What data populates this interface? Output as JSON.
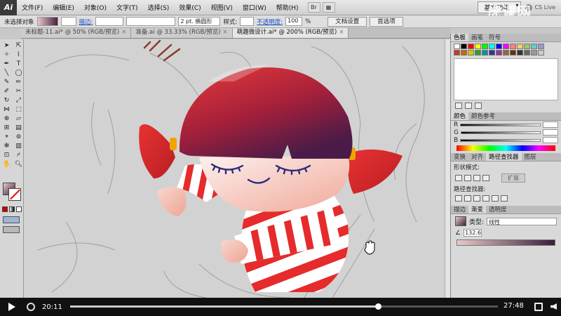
{
  "menubar": {
    "logo": "Ai",
    "items": [
      "文件(F)",
      "编辑(E)",
      "对象(O)",
      "文字(T)",
      "选择(S)",
      "效果(C)",
      "视图(V)",
      "窗口(W)",
      "帮助(H)"
    ],
    "workspace": "基本功能",
    "cs_live": "CS Live",
    "watermark": "虎课网"
  },
  "controlbar": {
    "selection_status": "未选择对象",
    "stroke_label": "描边:",
    "stroke_preset": "2 pt. 椭圆形",
    "style_label": "样式:",
    "opacity_label": "不透明度:",
    "opacity_value": "100",
    "opacity_unit": "%",
    "doc_settings": "文档设置",
    "preferences": "首选项"
  },
  "tabs": [
    {
      "label": "未标题-11.ai* @ 50% (RGB/预览)",
      "active": false
    },
    {
      "label": "准备.ai @ 33.33% (RGB/预览)",
      "active": false
    },
    {
      "label": "萌趣微设计.ai* @ 200% (RGB/预览)",
      "active": true
    }
  ],
  "panels": {
    "swatch_tabs": [
      "色板",
      "画笔",
      "符号"
    ],
    "color_tabs": [
      "颜色",
      "颜色参考"
    ],
    "slider_labels": [
      "R",
      "G",
      "B"
    ],
    "pathfinder_tabs": [
      "变换",
      "对齐",
      "路径查找器",
      "图层"
    ],
    "shape_modes": "形状模式:",
    "expand_button": "扩展",
    "pathfinders": "路径查找器:",
    "gradient_tabs": [
      "描边",
      "渐变",
      "透明度"
    ],
    "gradient_type_label": "类型:",
    "gradient_type": "线性",
    "gradient_angle": "132.6",
    "swatch_colors": [
      "#ffffff",
      "#000000",
      "#ff0000",
      "#ffff00",
      "#00ff00",
      "#00ffff",
      "#0000ff",
      "#ff00ff",
      "#ff8080",
      "#ffcc66",
      "#99cc66",
      "#66cccc",
      "#9999cc",
      "#cc3333",
      "#cc6600",
      "#cccc00",
      "#339933",
      "#009999",
      "#333399",
      "#993399",
      "#996633",
      "#663300",
      "#333333",
      "#666666",
      "#999999",
      "#cccccc"
    ]
  },
  "video": {
    "current_time": "20:11",
    "duration": "27:48",
    "progress_fraction": 0.72
  }
}
